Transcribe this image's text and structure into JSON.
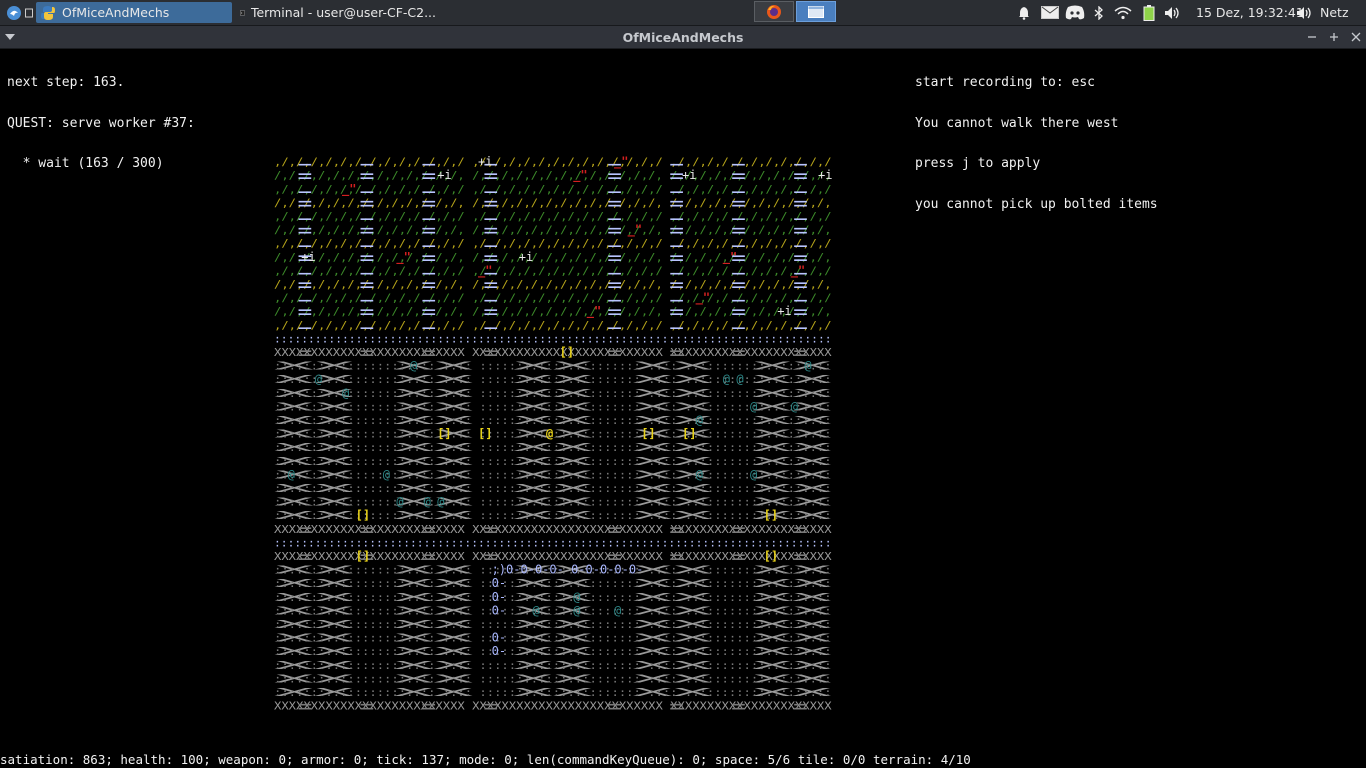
{
  "taskbar": {
    "active_task": "OfMiceAndMechs",
    "terminal_task": "Terminal - user@user-CF-C2...",
    "clock": "15 Dez, 19:32:41",
    "network": "Netz",
    "icons": [
      "app-menu-icon",
      "show-desktop-icon",
      "python-icon",
      "terminal-icon",
      "firefox-icon",
      "window-icon",
      "bell-icon",
      "mail-icon",
      "discord-icon",
      "bluetooth-icon",
      "wifi-icon",
      "battery-icon",
      "volume-icon"
    ]
  },
  "window": {
    "title": "OfMiceAndMechs",
    "controls": [
      "minimize",
      "maximize",
      "close"
    ]
  },
  "hud": {
    "left_lines": [
      "next step: 163.",
      "QUEST: serve worker #37:",
      "  * wait (163 / 300)"
    ],
    "right_lines": [
      "start recording to: esc",
      "You cannot walk there west",
      "press j to apply",
      "you cannot pick up bolted items"
    ],
    "status": "satiation: 863; health: 100; weapon: 0; armor: 0; tick: 137; mode: 0; len(commandKeyQueue): 0; space: 5/6 tile: 0/0 terrain: 4/10"
  },
  "colors": {
    "grass_green": "#3c8a2a",
    "grass_yellow": "#b6a41a",
    "wall_grey": "#9a9a9a",
    "floor_grey": "#7a7a7a",
    "path_blue": "#b8c4ff",
    "npc_teal": "#2e8a8a",
    "player_yellow": "#e8d21a",
    "item_white": "#eaeaea",
    "machine_blue": "#aab8ff",
    "enemy_red": "#d42020"
  }
}
